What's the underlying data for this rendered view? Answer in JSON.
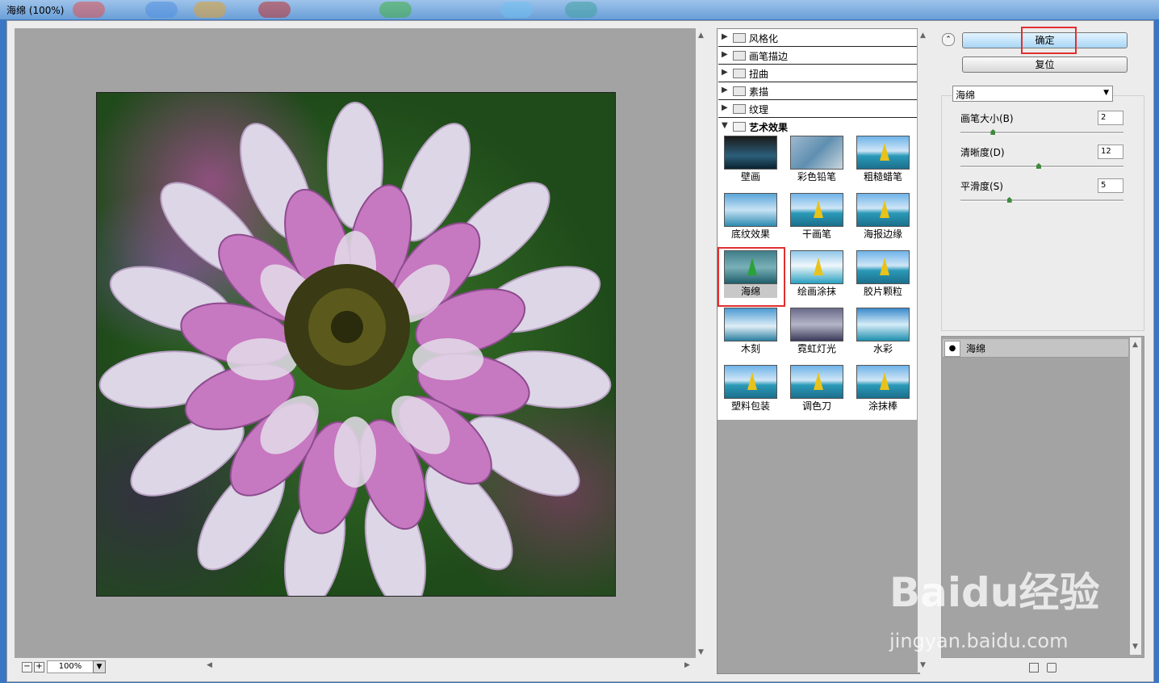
{
  "window": {
    "title": "海绵 (100%)"
  },
  "preview": {
    "zoom": "100%"
  },
  "filter_categories": [
    "风格化",
    "画笔描边",
    "扭曲",
    "素描",
    "纹理",
    "艺术效果"
  ],
  "expanded_category": "艺术效果",
  "filters": [
    "壁画",
    "彩色铅笔",
    "粗糙蜡笔",
    "底纹效果",
    "干画笔",
    "海报边缘",
    "海绵",
    "绘画涂抹",
    "胶片颗粒",
    "木刻",
    "霓虹灯光",
    "水彩",
    "塑料包装",
    "调色刀",
    "涂抹棒"
  ],
  "selected_filter": "海绵",
  "buttons": {
    "ok": "确定",
    "reset": "复位"
  },
  "filter_select": {
    "value": "海绵"
  },
  "params": [
    {
      "label": "画笔大小(B)",
      "value": "2",
      "level": 0.2
    },
    {
      "label": "清晰度(D)",
      "value": "12",
      "level": 0.48
    },
    {
      "label": "平滑度(S)",
      "value": "5",
      "level": 0.3
    }
  ],
  "layers": [
    {
      "name": "海绵",
      "visible": true
    }
  ],
  "watermark": {
    "brand": "Baidu经验",
    "url": "jingyan.baidu.com"
  },
  "colors": {
    "highlight": "#e03030",
    "panel_gray": "#a3a3a3"
  }
}
